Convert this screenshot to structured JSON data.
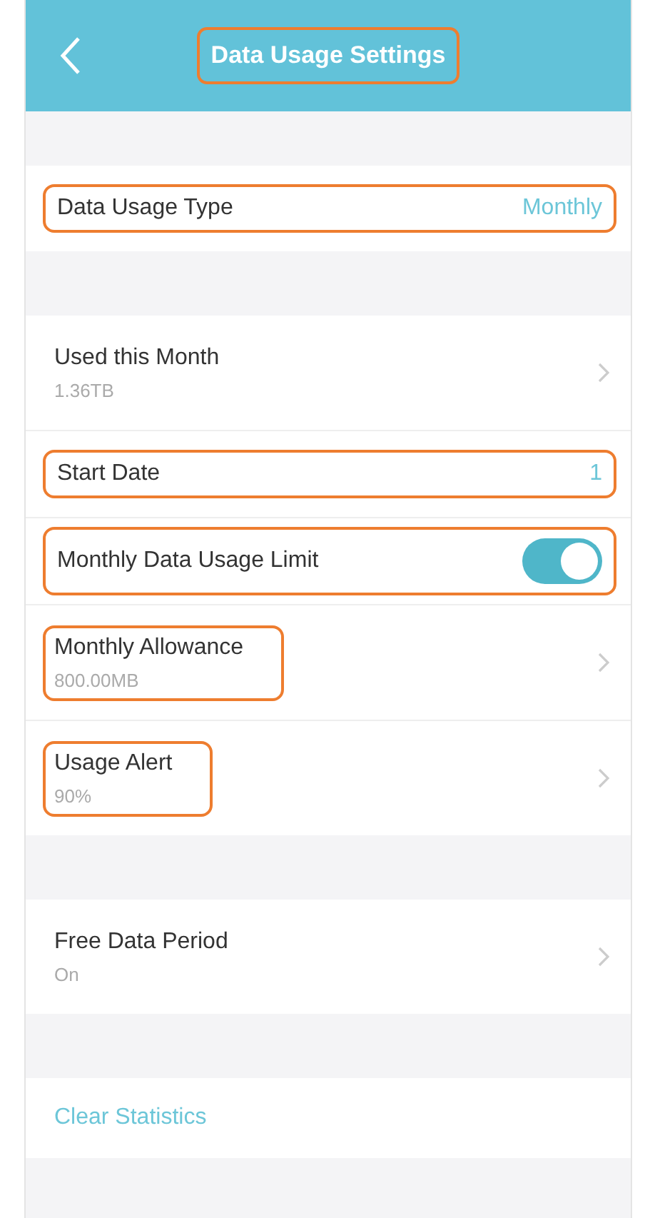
{
  "header": {
    "title": "Data Usage Settings",
    "title_highlighted": true
  },
  "sections": [
    {
      "items": [
        {
          "kind": "value",
          "label": "Data Usage Type",
          "value": "Monthly",
          "highlighted": true
        }
      ]
    },
    {
      "items": [
        {
          "kind": "nav",
          "label": "Used this Month",
          "subtitle": "1.36TB"
        },
        {
          "kind": "value",
          "label": "Start Date",
          "value": "1",
          "highlighted": true
        },
        {
          "kind": "toggle",
          "label": "Monthly Data Usage Limit",
          "on": true,
          "highlighted": true
        },
        {
          "kind": "nav",
          "label": "Monthly Allowance",
          "subtitle": "800.00MB",
          "highlighted": true
        },
        {
          "kind": "nav",
          "label": "Usage Alert",
          "subtitle": "90%",
          "highlighted": true
        }
      ]
    },
    {
      "items": [
        {
          "kind": "nav",
          "label": "Free Data Period",
          "subtitle": "On"
        }
      ]
    },
    {
      "items": [
        {
          "kind": "action",
          "label": "Clear Statistics"
        }
      ]
    }
  ]
}
